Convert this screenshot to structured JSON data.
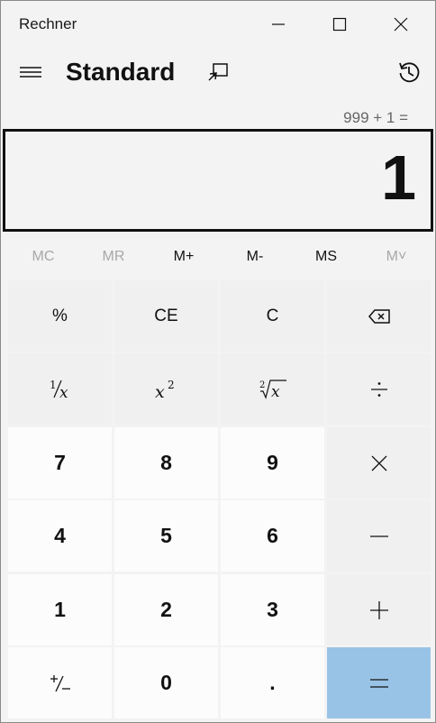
{
  "window": {
    "title": "Rechner"
  },
  "header": {
    "mode_title": "Standard"
  },
  "display": {
    "expression": "999 + 1 =",
    "value": "1"
  },
  "memory": {
    "mc": "MC",
    "mr": "MR",
    "m_plus": "M+",
    "m_minus": "M-",
    "ms": "MS",
    "m_list": "M˅"
  },
  "keys": {
    "percent": "%",
    "ce": "CE",
    "c": "C",
    "seven": "7",
    "eight": "8",
    "nine": "9",
    "four": "4",
    "five": "5",
    "six": "6",
    "one": "1",
    "two": "2",
    "three": "3",
    "zero": "0",
    "decimal": "."
  },
  "icons": {
    "minimize": "minimize-icon",
    "maximize": "maximize-icon",
    "close": "close-icon",
    "menu": "hamburger-icon",
    "keep_on_top": "keep-on-top-icon",
    "history": "history-icon",
    "backspace": "backspace-icon"
  },
  "colors": {
    "background": "#f3f3f3",
    "digit_key": "#fcfcfc",
    "function_key": "#f0f0f0",
    "equals_key": "#99c3e6",
    "disabled_text": "#a8a8a8"
  }
}
